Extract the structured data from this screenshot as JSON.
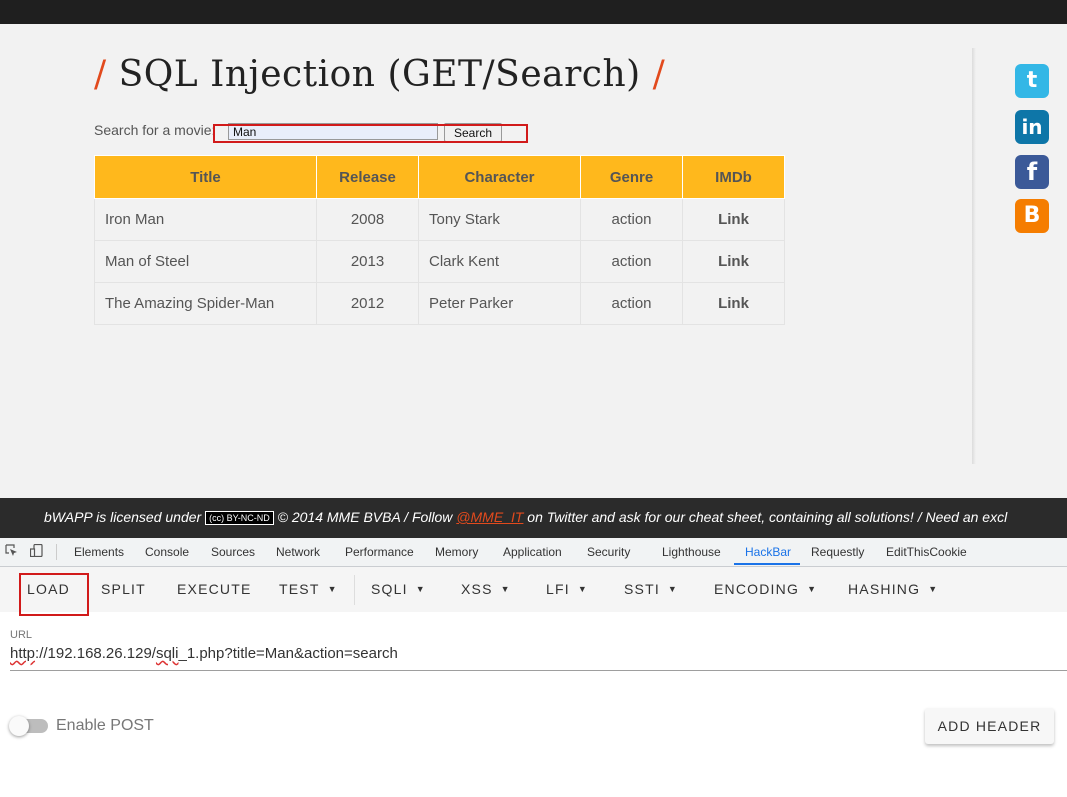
{
  "page": {
    "title": "SQL Injection (GET/Search)",
    "title_prefix": "/",
    "title_suffix": "/",
    "search_label": "Search for a movie:",
    "search_value": "Man",
    "search_button": "Search"
  },
  "table": {
    "headers": [
      "Title",
      "Release",
      "Character",
      "Genre",
      "IMDb"
    ],
    "rows": [
      {
        "title": "Iron Man",
        "release": "2008",
        "character": "Tony Stark",
        "genre": "action",
        "imdb": "Link"
      },
      {
        "title": "Man of Steel",
        "release": "2013",
        "character": "Clark Kent",
        "genre": "action",
        "imdb": "Link"
      },
      {
        "title": "The Amazing Spider-Man",
        "release": "2012",
        "character": "Peter Parker",
        "genre": "action",
        "imdb": "Link"
      }
    ]
  },
  "social": {
    "twitter": "t",
    "linkedin": "in",
    "facebook": "f",
    "blogger": "B"
  },
  "footer": {
    "text_before": "bWAPP is licensed under",
    "license_badge": "(cc) BY-NC-ND",
    "text_middle": "© 2014 MME BVBA / Follow",
    "handle": "@MME_IT",
    "text_after": "on Twitter and ask for our cheat sheet, containing all solutions! / Need an excl"
  },
  "devtools": {
    "tabs": [
      "Elements",
      "Console",
      "Sources",
      "Network",
      "Performance",
      "Memory",
      "Application",
      "Security",
      "Lighthouse",
      "HackBar",
      "Requestly",
      "EditThisCookie"
    ],
    "active_tab": "HackBar"
  },
  "hackbar": {
    "buttons": [
      "LOAD",
      "SPLIT",
      "EXECUTE",
      "TEST",
      "SQLI",
      "XSS",
      "LFI",
      "SSTI",
      "ENCODING",
      "HASHING"
    ],
    "url_label": "URL",
    "url_part1": "http",
    "url_part2": "://192.168.26.129/",
    "url_part3": "sqli",
    "url_part4": "_1.php?title=Man&action=search",
    "enable_post_label": "Enable POST",
    "enable_post": false,
    "add_header_label": "ADD HEADER"
  },
  "colors": {
    "accent_orange": "#ffb81c",
    "title_slash": "#e24a1d",
    "highlight_box": "#d11a1a",
    "devtools_active": "#1a73e8"
  }
}
